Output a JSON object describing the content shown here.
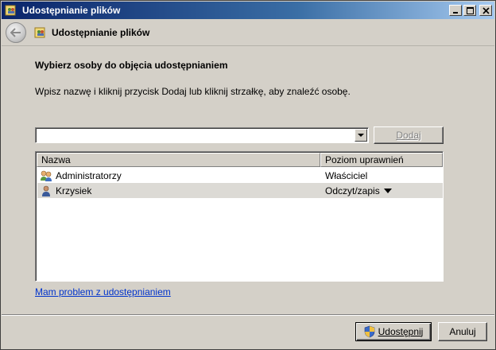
{
  "window": {
    "title": "Udostępnianie plików"
  },
  "nav": {
    "title": "Udostępnianie plików"
  },
  "content": {
    "heading": "Wybierz osoby do objęcia udostępnianiem",
    "instruction": "Wpisz nazwę i kliknij przycisk Dodaj lub kliknij strzałkę, aby znaleźć osobę.",
    "input_value": "",
    "add_button": "Dodaj"
  },
  "list": {
    "columns": [
      "Nazwa",
      "Poziom uprawnień"
    ],
    "rows": [
      {
        "name": "Administratorzy",
        "permission": "Właściciel",
        "icon": "group-icon"
      },
      {
        "name": "Krzysiek",
        "permission": "Odczyt/zapis",
        "icon": "user-icon"
      }
    ]
  },
  "help_link": "Mam problem z udostępnianiem",
  "buttons": {
    "share": "Udostępnij",
    "cancel": "Anuluj"
  },
  "colors": {
    "titlebar_start": "#0a246a",
    "titlebar_end": "#a6caf0",
    "link": "#0033cc",
    "window_bg": "#d4d0c8"
  }
}
